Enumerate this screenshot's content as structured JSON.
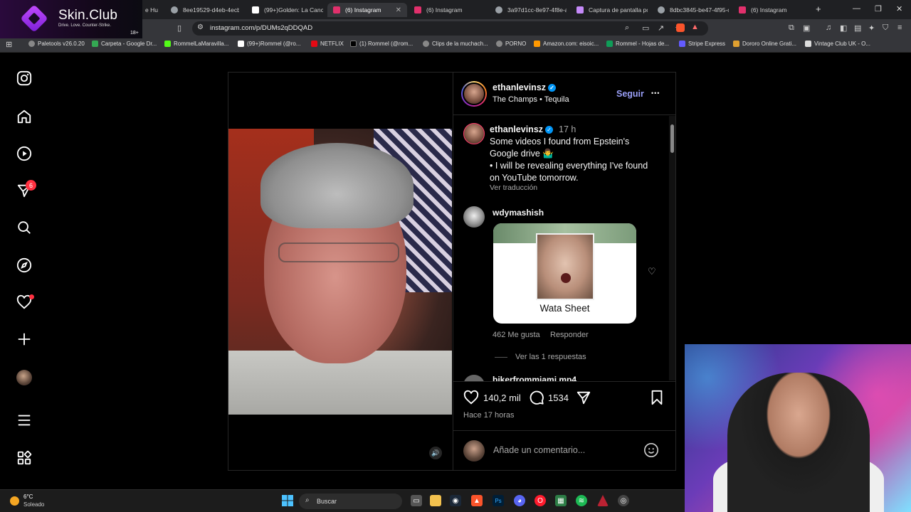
{
  "browser": {
    "tabs": [
      {
        "label": "e Hun",
        "color": "#444444",
        "active": false
      },
      {
        "label": "8ee19529-d4eb-4ecb",
        "color": "#9aa0a6",
        "active": false
      },
      {
        "label": "(99+)Golden: La Canci",
        "color": "#ffffff",
        "active": false
      },
      {
        "label": "(6) Instagram",
        "color": "#e1306c",
        "active": true
      },
      {
        "label": "(6) Instagram",
        "color": "#e1306c",
        "active": false
      },
      {
        "label": "3a97d1cc-8e97-4f8e-a",
        "color": "#9aa0a6",
        "active": false
      },
      {
        "label": "Captura de pantalla pc",
        "color": "#c58af9",
        "active": false
      },
      {
        "label": "8dbc3845-be47-4f95-c",
        "color": "#9aa0a6",
        "active": false
      },
      {
        "label": "(6) Instagram",
        "color": "#e1306c",
        "active": false
      }
    ],
    "new_tab": "+",
    "url": "instagram.com/p/DUMs2qDDQAD",
    "bookmarks": [
      "Paletools v26.0.20",
      "Carpeta - Google Dr...",
      "RommelLaMaravilla...",
      "(99+)Rommel (@ro...",
      "NETFLIX",
      "(1) Rommel (@rom...",
      "Clips de la muchach...",
      "PORNO",
      "Amazon.com: eisoic...",
      "Rommel - Hojas de...",
      "Stripe Express",
      "Dororo Online Grati...",
      "Vintage Club UK - O..."
    ]
  },
  "ad": {
    "title": "Skin.Club",
    "subtitle": "Drive. Love. Counter-Strike.",
    "age": "18+"
  },
  "sidebar": {
    "notification_count": "6"
  },
  "post": {
    "author": "ethanlevinsz",
    "audio": "The Champs • Tequila",
    "follow": "Seguir",
    "more": "•••",
    "caption_time": "17 h",
    "caption_line1": "Some videos I found from Epstein's",
    "caption_line2": "Google drive 🤷‍♂️",
    "caption_line3": "• I will be revealing everything I've found",
    "caption_line4": "on YouTube tomorrow.",
    "translate": "Ver traducción",
    "comment_user": "wdymashish",
    "gif_caption": "Wata Sheet",
    "comment_likes": "462 Me gusta",
    "reply": "Responder",
    "view_replies": "Ver las 1 respuestas",
    "next_user": "bikerfrommiami.mp4",
    "likes": "140,2 mil",
    "comments": "1534",
    "time_ago": "Hace 17 horas",
    "add_comment": "Añade un comentario..."
  },
  "taskbar": {
    "weather_temp": "6°C",
    "weather_desc": "Soleado",
    "search": "Buscar"
  }
}
